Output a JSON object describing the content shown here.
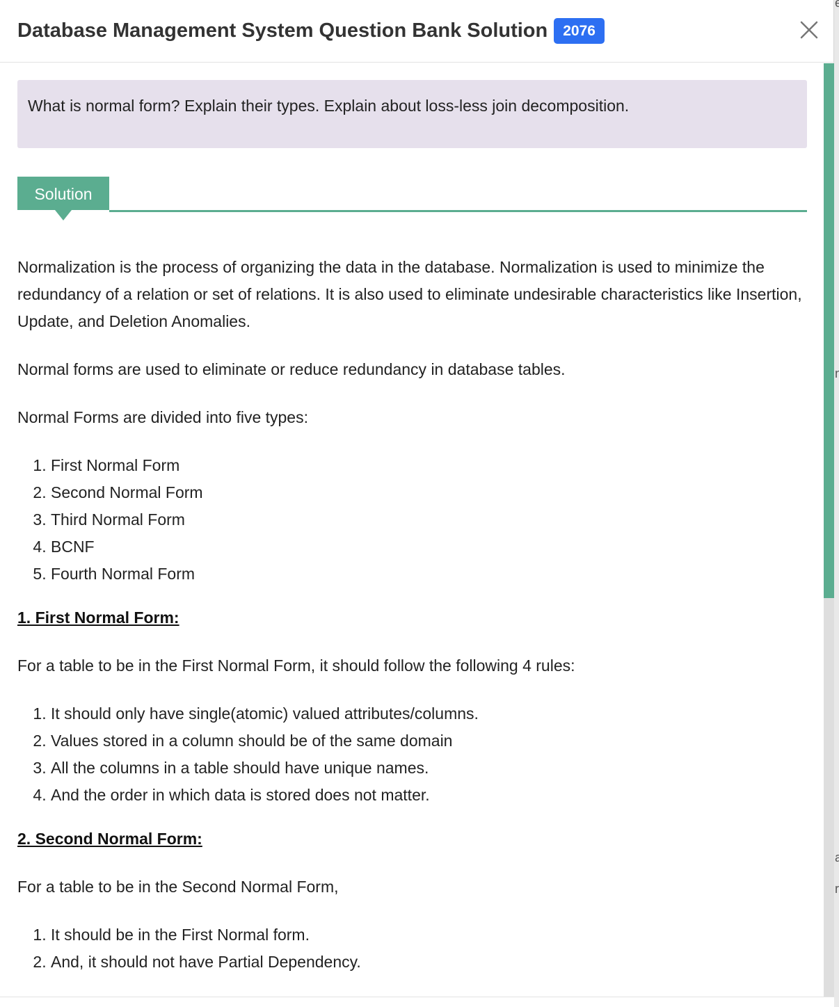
{
  "modal": {
    "title": "Database Management System Question Bank Solution",
    "year_badge": "2076",
    "close_icon": "close-icon"
  },
  "background_fragments": [
    "e",
    "n",
    "a",
    "r"
  ],
  "question": {
    "text": "What is normal form? Explain their types. Explain about loss-less join decomposition."
  },
  "solution_tab": {
    "label": "Solution"
  },
  "content": {
    "intro": "Normalization is the process of organizing the data in the database. Normalization is used to minimize the redundancy of a relation or set of relations. It is also used to eliminate undesirable characteristics like Insertion, Update, and Deletion Anomalies.",
    "purpose": "Normal forms are used to eliminate or reduce redundancy in database tables.",
    "types_intro": "Normal Forms are divided into five types:",
    "types": [
      "First Normal Form",
      "Second Normal Form",
      "Third Normal Form",
      "BCNF",
      "Fourth Normal Form"
    ],
    "first_nf": {
      "heading": "1. First Normal Form:",
      "intro": "For a table to be in the First Normal Form, it should follow the following 4 rules:",
      "rules": [
        "It should only have single(atomic) valued attributes/columns.",
        "Values stored in a column should be of the same domain",
        "All the columns in a table should have unique names.",
        "And the order in which data is stored does not matter."
      ]
    },
    "second_nf": {
      "heading": "2. Second Normal Form:",
      "intro": "For a table to be in the Second Normal Form,",
      "rules": [
        "It should be in the First Normal form.",
        "And, it should not have Partial Dependency."
      ]
    }
  },
  "colors": {
    "accent_green": "#5bad90",
    "badge_blue": "#2d6ff2",
    "question_bg": "#e6e0ec"
  }
}
